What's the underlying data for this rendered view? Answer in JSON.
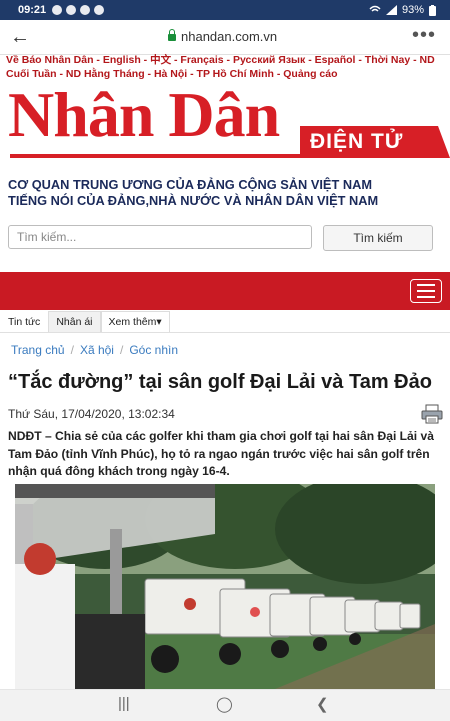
{
  "status": {
    "time": "09:21",
    "battery": "93%"
  },
  "browser": {
    "url": "nhandan.com.vn",
    "back_icon": "arrow-left-icon",
    "menu_icon": "more-dots-icon"
  },
  "top_links": "Về Báo Nhân Dân - English - 中文 - Français - Русский Язык - Español - Thời Nay - ND Cuối Tuần - ND Hằng Tháng - Hà Nội - TP Hồ Chí Minh - Quảng cáo",
  "logo": {
    "name": "Nhân Dân",
    "badge": "ĐIỆN TỬ"
  },
  "tagline": {
    "line1": "CƠ QUAN TRUNG ƯƠNG CỦA ĐẢNG CỘNG SẢN VIỆT NAM",
    "line2": "TIẾNG NÓI CỦA ĐẢNG,NHÀ NƯỚC VÀ NHÂN DÂN VIỆT NAM"
  },
  "search": {
    "placeholder": "Tìm kiếm...",
    "button": "Tìm kiếm"
  },
  "tabs": {
    "news": "Tin tức",
    "popular": "Nhân ái",
    "more": "Xem thêm▾"
  },
  "breadcrumb": {
    "home": "Trang chủ",
    "section": "Xã hội",
    "sub": "Góc nhìn",
    "sep": "/"
  },
  "article": {
    "title": "“Tắc đường” tại sân golf Đại Lải và Tam Đảo",
    "date": "Thứ Sáu, 17/04/2020, 13:02:34",
    "lead": "NDĐT – Chia sẻ của các golfer khi tham gia chơi golf tại hai sân Đại Lải và Tam Đảo (tỉnh Vĩnh Phúc), họ tỏ ra ngao ngán trước việc hai sân golf trên nhận quá đông khách trong ngày 16-4."
  },
  "colors": {
    "brand_red": "#d71f26",
    "statusbar": "#1f3a68",
    "tagline": "#1b2a5a",
    "link": "#3a7bbf"
  }
}
